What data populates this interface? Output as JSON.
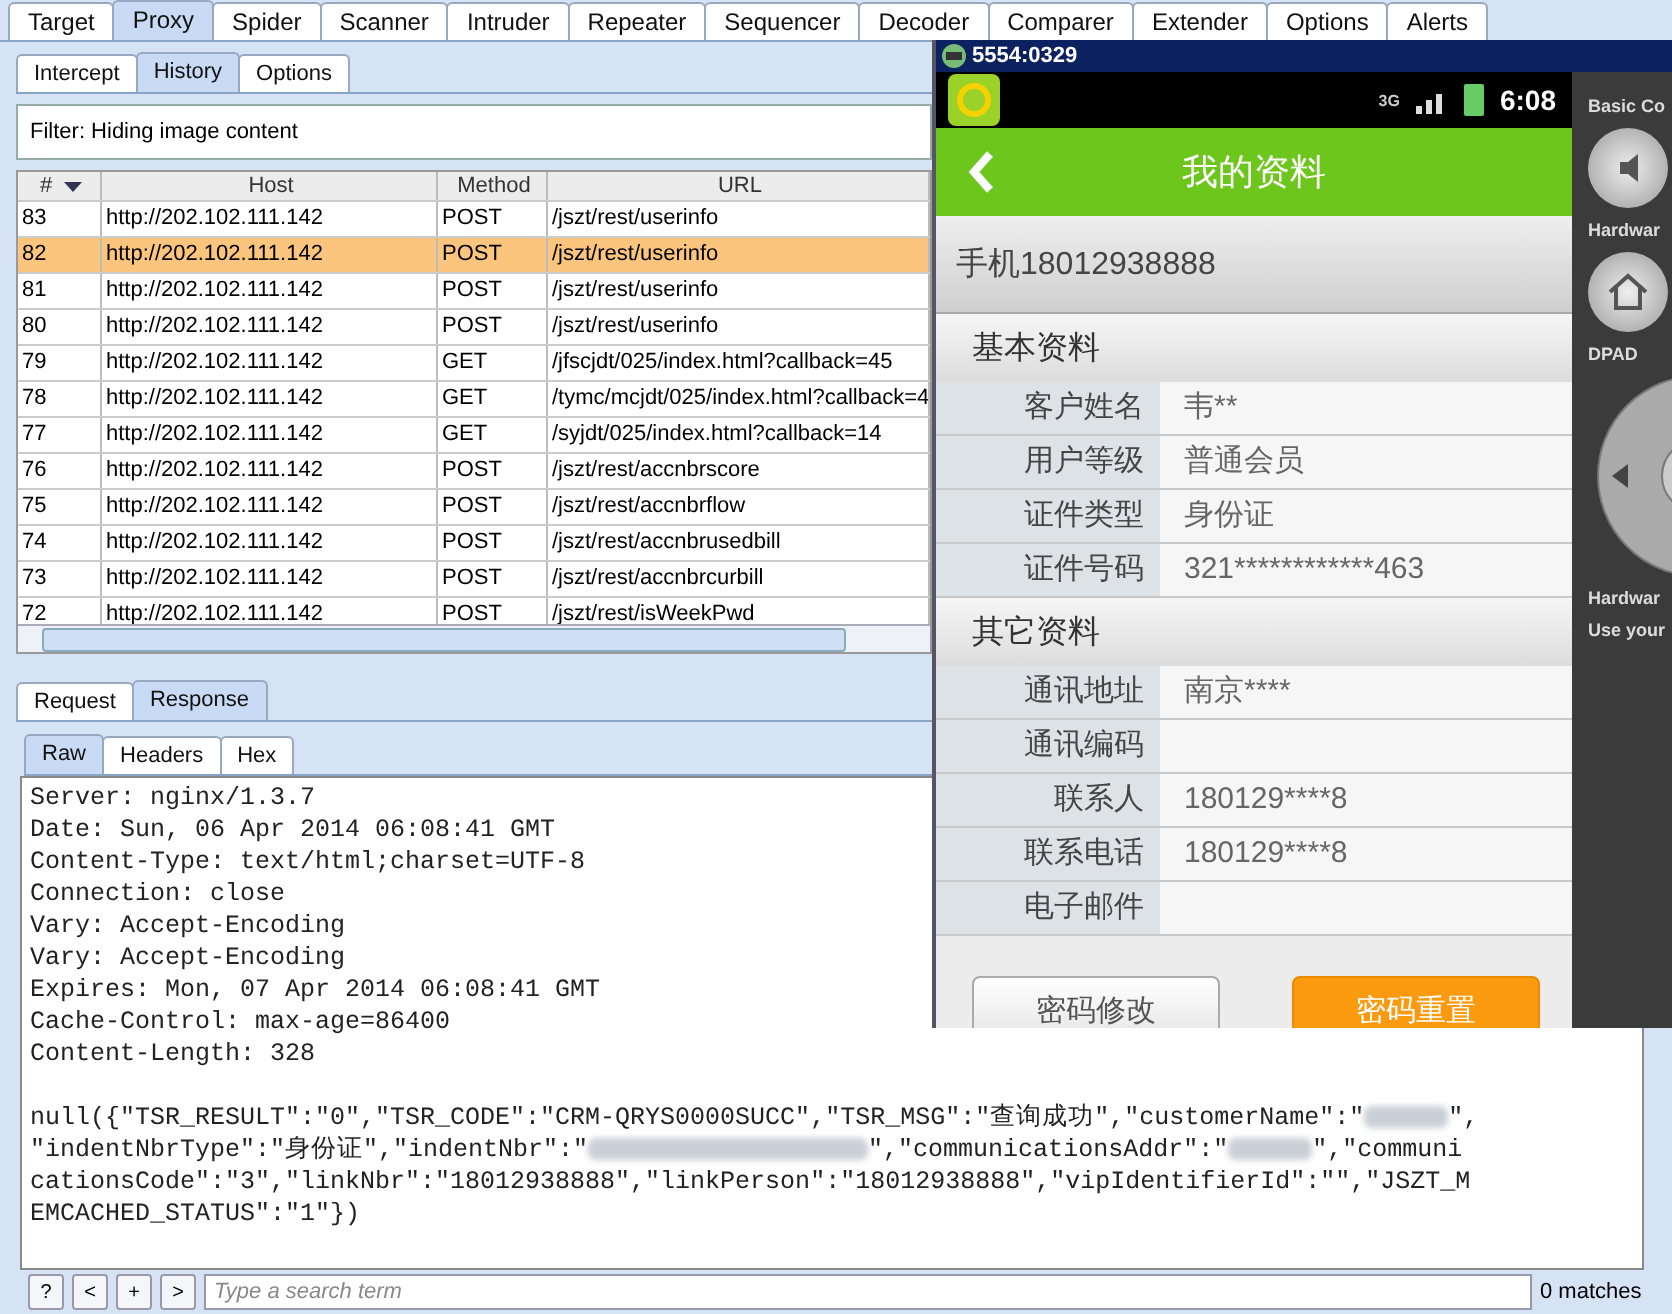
{
  "burp": {
    "tabs": [
      {
        "label": "Target",
        "selected": false
      },
      {
        "label": "Proxy",
        "selected": true
      },
      {
        "label": "Spider",
        "selected": false
      },
      {
        "label": "Scanner",
        "selected": false
      },
      {
        "label": "Intruder",
        "selected": false
      },
      {
        "label": "Repeater",
        "selected": false
      },
      {
        "label": "Sequencer",
        "selected": false
      },
      {
        "label": "Decoder",
        "selected": false
      },
      {
        "label": "Comparer",
        "selected": false
      },
      {
        "label": "Extender",
        "selected": false
      },
      {
        "label": "Options",
        "selected": false
      },
      {
        "label": "Alerts",
        "selected": false
      }
    ],
    "proxy_tabs": [
      {
        "label": "Intercept",
        "selected": false
      },
      {
        "label": "History",
        "selected": true
      },
      {
        "label": "Options",
        "selected": false
      }
    ],
    "filter": "Filter:  Hiding image content",
    "table": {
      "columns": [
        "#",
        "Host",
        "Method",
        "URL"
      ],
      "rows": [
        {
          "cells": [
            "83",
            "http://202.102.111.142",
            "POST",
            "/jszt/rest/userinfo"
          ],
          "selected": false
        },
        {
          "cells": [
            "82",
            "http://202.102.111.142",
            "POST",
            "/jszt/rest/userinfo"
          ],
          "selected": true
        },
        {
          "cells": [
            "81",
            "http://202.102.111.142",
            "POST",
            "/jszt/rest/userinfo"
          ],
          "selected": false
        },
        {
          "cells": [
            "80",
            "http://202.102.111.142",
            "POST",
            "/jszt/rest/userinfo"
          ],
          "selected": false
        },
        {
          "cells": [
            "79",
            "http://202.102.111.142",
            "GET",
            "/jfscjdt/025/index.html?callback=45"
          ],
          "selected": false
        },
        {
          "cells": [
            "78",
            "http://202.102.111.142",
            "GET",
            "/tymc/mcjdt/025/index.html?callback=4"
          ],
          "selected": false
        },
        {
          "cells": [
            "77",
            "http://202.102.111.142",
            "GET",
            "/syjdt/025/index.html?callback=14"
          ],
          "selected": false
        },
        {
          "cells": [
            "76",
            "http://202.102.111.142",
            "POST",
            "/jszt/rest/accnbrscore"
          ],
          "selected": false
        },
        {
          "cells": [
            "75",
            "http://202.102.111.142",
            "POST",
            "/jszt/rest/accnbrflow"
          ],
          "selected": false
        },
        {
          "cells": [
            "74",
            "http://202.102.111.142",
            "POST",
            "/jszt/rest/accnbrusedbill"
          ],
          "selected": false
        },
        {
          "cells": [
            "73",
            "http://202.102.111.142",
            "POST",
            "/jszt/rest/accnbrcurbill"
          ],
          "selected": false
        },
        {
          "cells": [
            "72",
            "http://202.102.111.142",
            "POST",
            "/jszt/rest/isWeekPwd"
          ],
          "selected": false
        }
      ]
    },
    "message_tabs": [
      {
        "label": "Request",
        "selected": false
      },
      {
        "label": "Response",
        "selected": true
      }
    ],
    "view_tabs": [
      {
        "label": "Raw",
        "selected": true
      },
      {
        "label": "Headers",
        "selected": false
      },
      {
        "label": "Hex",
        "selected": false
      }
    ],
    "headers": [
      "Server: nginx/1.3.7",
      "Date: Sun, 06 Apr 2014 06:08:41 GMT",
      "Content-Type: text/html;charset=UTF-8",
      "Connection: close",
      "Vary: Accept-Encoding",
      "Vary: Accept-Encoding",
      "Expires: Mon, 07 Apr 2014 06:08:41 GMT",
      "Cache-Control: max-age=86400",
      "Content-Length: 328"
    ],
    "body": [
      [
        {
          "kind": "text",
          "text": "null({\"TSR_RESULT\":\"0\",\"TSR_CODE\":\"CRM-QRYS0000SUCC\",\"TSR_MSG\":\"查询成功\",\"customerName\":\""
        },
        {
          "kind": "blur"
        },
        {
          "kind": "text",
          "text": "\","
        }
      ],
      [
        {
          "kind": "text",
          "text": "\"indentNbrType\":\"身份证\",\"indentNbr\":\""
        },
        {
          "kind": "blurlong"
        },
        {
          "kind": "text",
          "text": "\",\"communicationsAddr\":\""
        },
        {
          "kind": "blur"
        },
        {
          "kind": "text",
          "text": "\",\"communi"
        }
      ],
      [
        {
          "kind": "text",
          "text": "cationsCode\":\"3\",\"linkNbr\":\"18012938888\",\"linkPerson\":\"18012938888\",\"vipIdentifierId\":\"\",\"JSZT_M"
        }
      ],
      [
        {
          "kind": "text",
          "text": "EMCACHED_STATUS\":\"1\"})"
        }
      ]
    ],
    "search": {
      "buttons": [
        "?",
        "<",
        "+",
        ">"
      ],
      "placeholder": "Type a search term",
      "matches": "0 matches"
    }
  },
  "emulator": {
    "title": "5554:0329",
    "network": "3G",
    "time": "6:08",
    "page_title": "我的资料",
    "phone": "手机18012938888",
    "sections": [
      {
        "title": "基本资料",
        "rows": [
          {
            "label": "客户姓名",
            "value": "韦**"
          },
          {
            "label": "用户等级",
            "value": "普通会员"
          },
          {
            "label": "证件类型",
            "value": "身份证"
          },
          {
            "label": "证件号码",
            "value": "321************463"
          }
        ]
      },
      {
        "title": "其它资料",
        "rows": [
          {
            "label": "通讯地址",
            "value": "南京****"
          },
          {
            "label": "通讯编码"
          },
          {
            "label": "联系人",
            "value": "180129****8"
          },
          {
            "label": "联系电话",
            "value": "180129****8"
          },
          {
            "label": "电子邮件"
          }
        ]
      }
    ],
    "buttons": [
      {
        "label": "密码修改",
        "kind": "secondary"
      },
      {
        "label": "密码重置",
        "kind": "primary"
      }
    ],
    "controls": [
      {
        "kind": "label",
        "text": "Basic Co"
      },
      {
        "kind": "speaker"
      },
      {
        "kind": "label",
        "text": "Hardwar"
      },
      {
        "kind": "home"
      },
      {
        "kind": "label",
        "text": "DPAD"
      },
      {
        "kind": "dpad"
      },
      {
        "kind": "label",
        "text": "Hardwar"
      },
      {
        "kind": "label",
        "text": "Use your"
      }
    ]
  }
}
